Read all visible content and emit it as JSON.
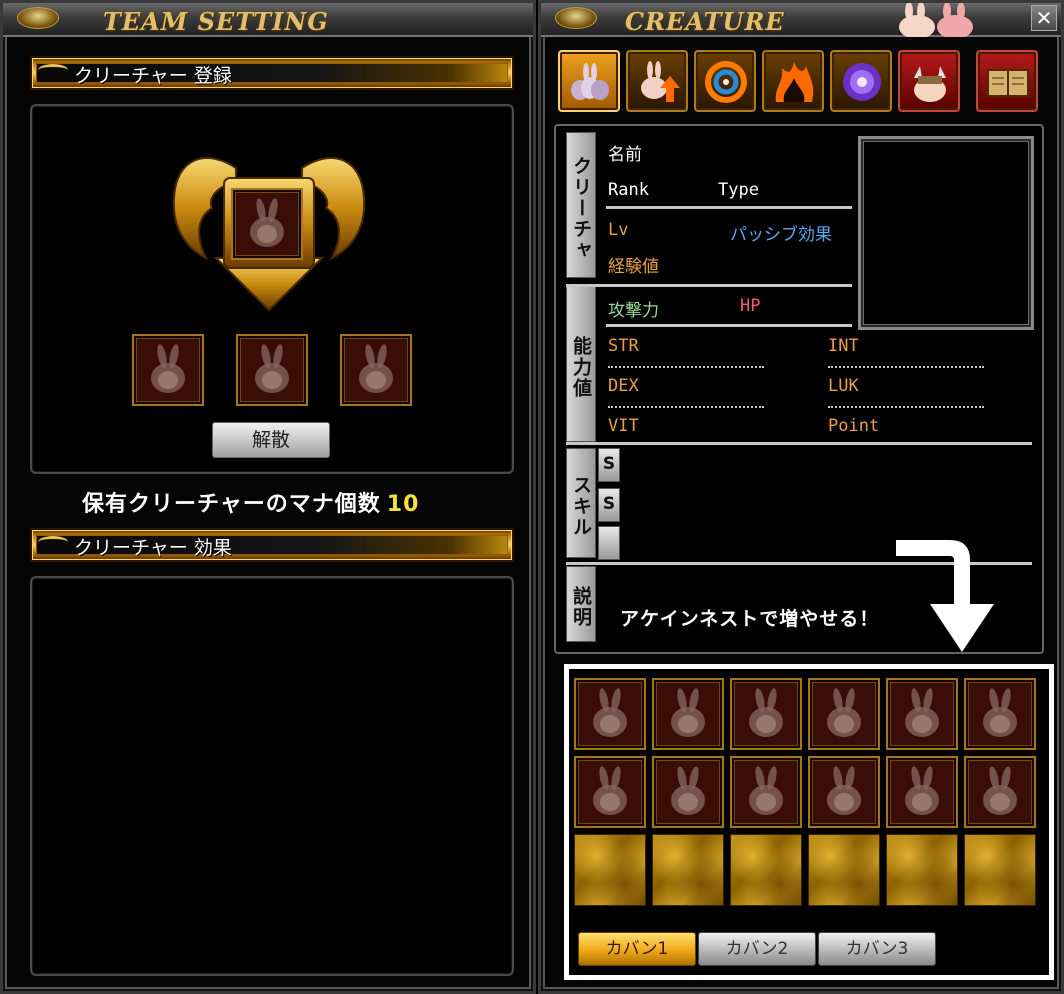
{
  "team_setting": {
    "title": "TEAM SETTING",
    "register_header": "クリーチャー 登録",
    "disband_button": "解散",
    "mana_label": "保有クリーチャーのマナ個数",
    "mana_count": "10",
    "effect_header": "クリーチャー 効果",
    "register_slots": [
      {
        "icon": "creature-placeholder-icon"
      },
      {
        "icon": "creature-placeholder-icon"
      },
      {
        "icon": "creature-placeholder-icon"
      }
    ]
  },
  "creature": {
    "title": "CREATURE",
    "close_glyph": "✕",
    "tabs": [
      {
        "icon": "creature-list-icon",
        "style": "normal"
      },
      {
        "icon": "creature-upgrade-icon",
        "style": "normal"
      },
      {
        "icon": "fusion-swirl-icon",
        "style": "normal"
      },
      {
        "icon": "fire-creature-icon",
        "style": "normal"
      },
      {
        "icon": "magic-orb-icon",
        "style": "normal"
      },
      {
        "icon": "viking-creature-icon",
        "style": "red"
      },
      {
        "icon": "book-icon",
        "style": "red"
      }
    ],
    "info": {
      "vtab_creature": "クリーチャ",
      "vtab_ability": "能力値",
      "vtab_skill": "スキル",
      "vtab_desc": "説明",
      "name_label": "名前",
      "rank_label": "Rank",
      "type_label": "Type",
      "lv_label": "Lv",
      "passive_label": "パッシブ効果",
      "exp_label": "経験値",
      "atk_label": "攻撃力",
      "hp_label": "HP",
      "str_label": "STR",
      "int_label": "INT",
      "dex_label": "DEX",
      "luk_label": "LUK",
      "vit_label": "VIT",
      "point_label": "Point",
      "skill_slots": [
        "S",
        "S",
        ""
      ]
    },
    "callout_text": "アケインネストで増やせる！",
    "inventory": {
      "rows": [
        [
          "creature",
          "creature",
          "creature",
          "creature",
          "creature",
          "creature"
        ],
        [
          "creature",
          "creature",
          "creature",
          "creature",
          "creature",
          "creature"
        ],
        [
          "locked",
          "locked",
          "locked",
          "locked",
          "locked",
          "locked"
        ]
      ],
      "bags": [
        {
          "label": "カバン1",
          "active": true
        },
        {
          "label": "カバン2",
          "active": false
        },
        {
          "label": "カバン3",
          "active": false
        }
      ]
    }
  },
  "colors": {
    "gold": "#c9870f",
    "mana_number": "#f3e03a",
    "stat_orange": "#e8a040",
    "passive_blue": "#5aa8f0",
    "atk_green": "#9ad89a",
    "hp_red": "#ff5a7a",
    "active_bag": "#f0a818"
  }
}
